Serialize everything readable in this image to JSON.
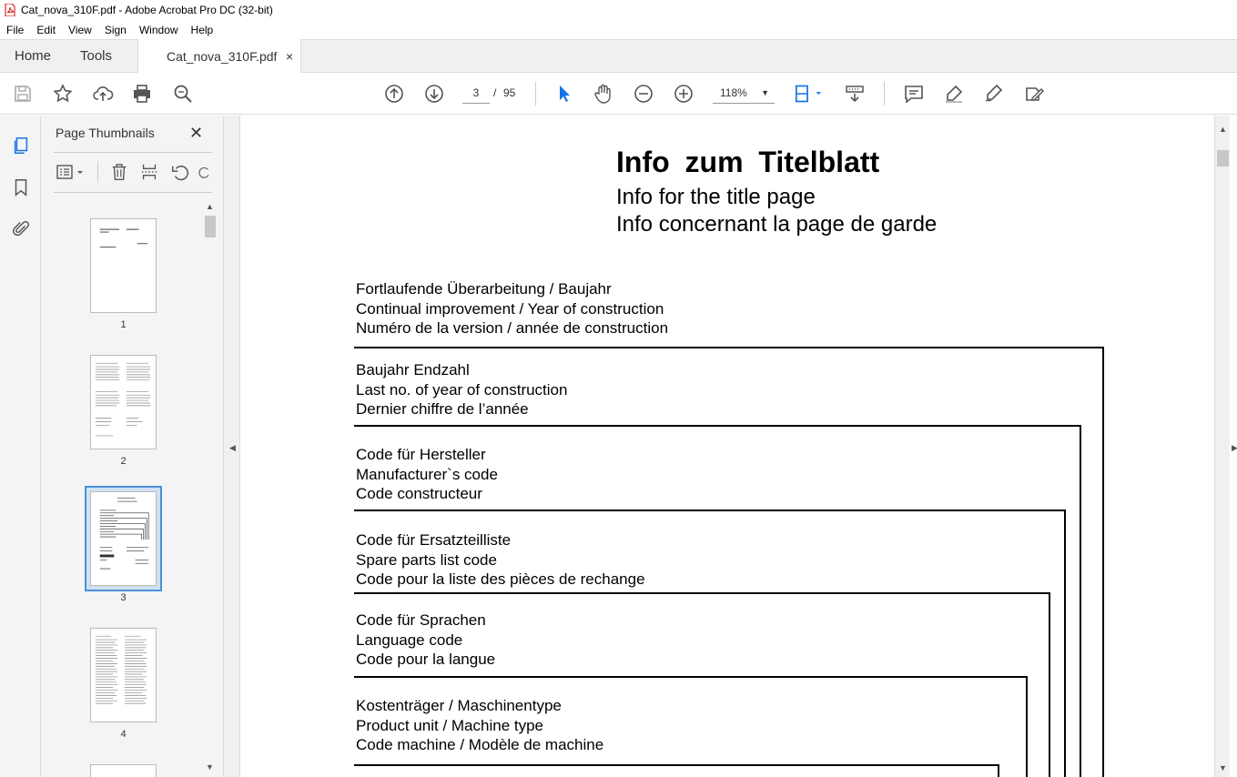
{
  "window": {
    "title": "Cat_nova_310F.pdf - Adobe Acrobat Pro DC (32-bit)"
  },
  "menu": {
    "items": [
      "File",
      "Edit",
      "View",
      "Sign",
      "Window",
      "Help"
    ]
  },
  "tabs": {
    "home": "Home",
    "tools": "Tools",
    "document": "Cat_nova_310F.pdf",
    "close": "×"
  },
  "navigation": {
    "current_page": "3",
    "separator": "/",
    "total_pages": "95",
    "zoom": "118%"
  },
  "thumbnails_panel": {
    "title": "Page Thumbnails",
    "close": "✕",
    "pages": [
      {
        "label": "1"
      },
      {
        "label": "2"
      },
      {
        "label": "3",
        "selected": true
      },
      {
        "label": "4"
      }
    ]
  },
  "document": {
    "title": "Info  zum  Titelblatt",
    "subtitle_en": "Info for the title page",
    "subtitle_fr": "Info concernant la page de garde",
    "blocks": [
      {
        "de": "Fortlaufende Überarbeitung / Baujahr",
        "en": "Continual improvement / Year of construction",
        "fr": "Numéro de la version / année de construction"
      },
      {
        "de": "Baujahr Endzahl",
        "en": "Last no. of year of construction",
        "fr": "Dernier chiffre de l’année"
      },
      {
        "de": "Code für Hersteller",
        "en": "Manufacturer`s  code",
        "fr": "Code constructeur"
      },
      {
        "de": "Code für Ersatzteilliste",
        "en": "Spare parts list code",
        "fr": "Code pour la liste des pièces de rechange"
      },
      {
        "de": "Code für Sprachen",
        "en": "Language code",
        "fr": "Code pour la langue"
      },
      {
        "de": "Kostenträger / Maschinentype",
        "en": "Product unit / Machine type",
        "fr": "Code machine / Modèle de machine"
      }
    ]
  },
  "colors": {
    "selection": "#4a90d9",
    "accent_blue": "#1473e6"
  }
}
